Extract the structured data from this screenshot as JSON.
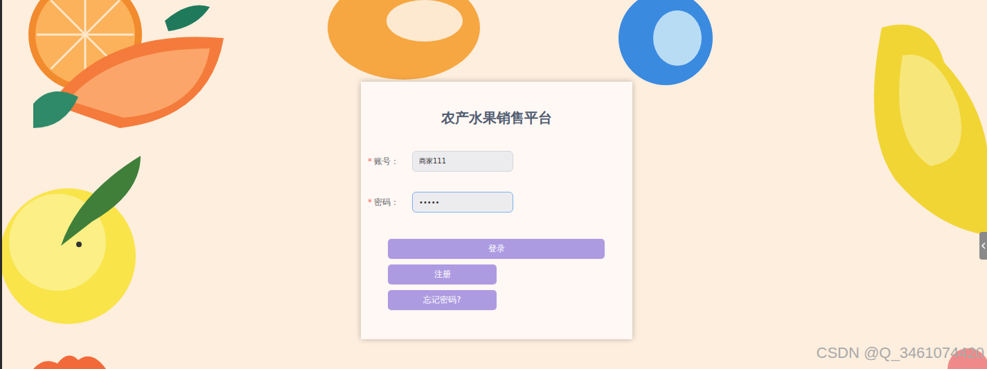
{
  "window": {
    "title": "农产水果销售平台"
  },
  "required_mark": "*",
  "fields": [
    {
      "label": "账号：",
      "value": "商家111",
      "required": true,
      "focused": false
    },
    {
      "label": "密码：",
      "value": "•••••",
      "required": true,
      "focused": true
    }
  ],
  "buttons": [
    {
      "label": "登录",
      "kind": "wide"
    },
    {
      "label": "注册",
      "kind": "half"
    },
    {
      "label": "忘记密码?",
      "kind": "half"
    }
  ],
  "watermark": "CSDN @Q_3461074420"
}
